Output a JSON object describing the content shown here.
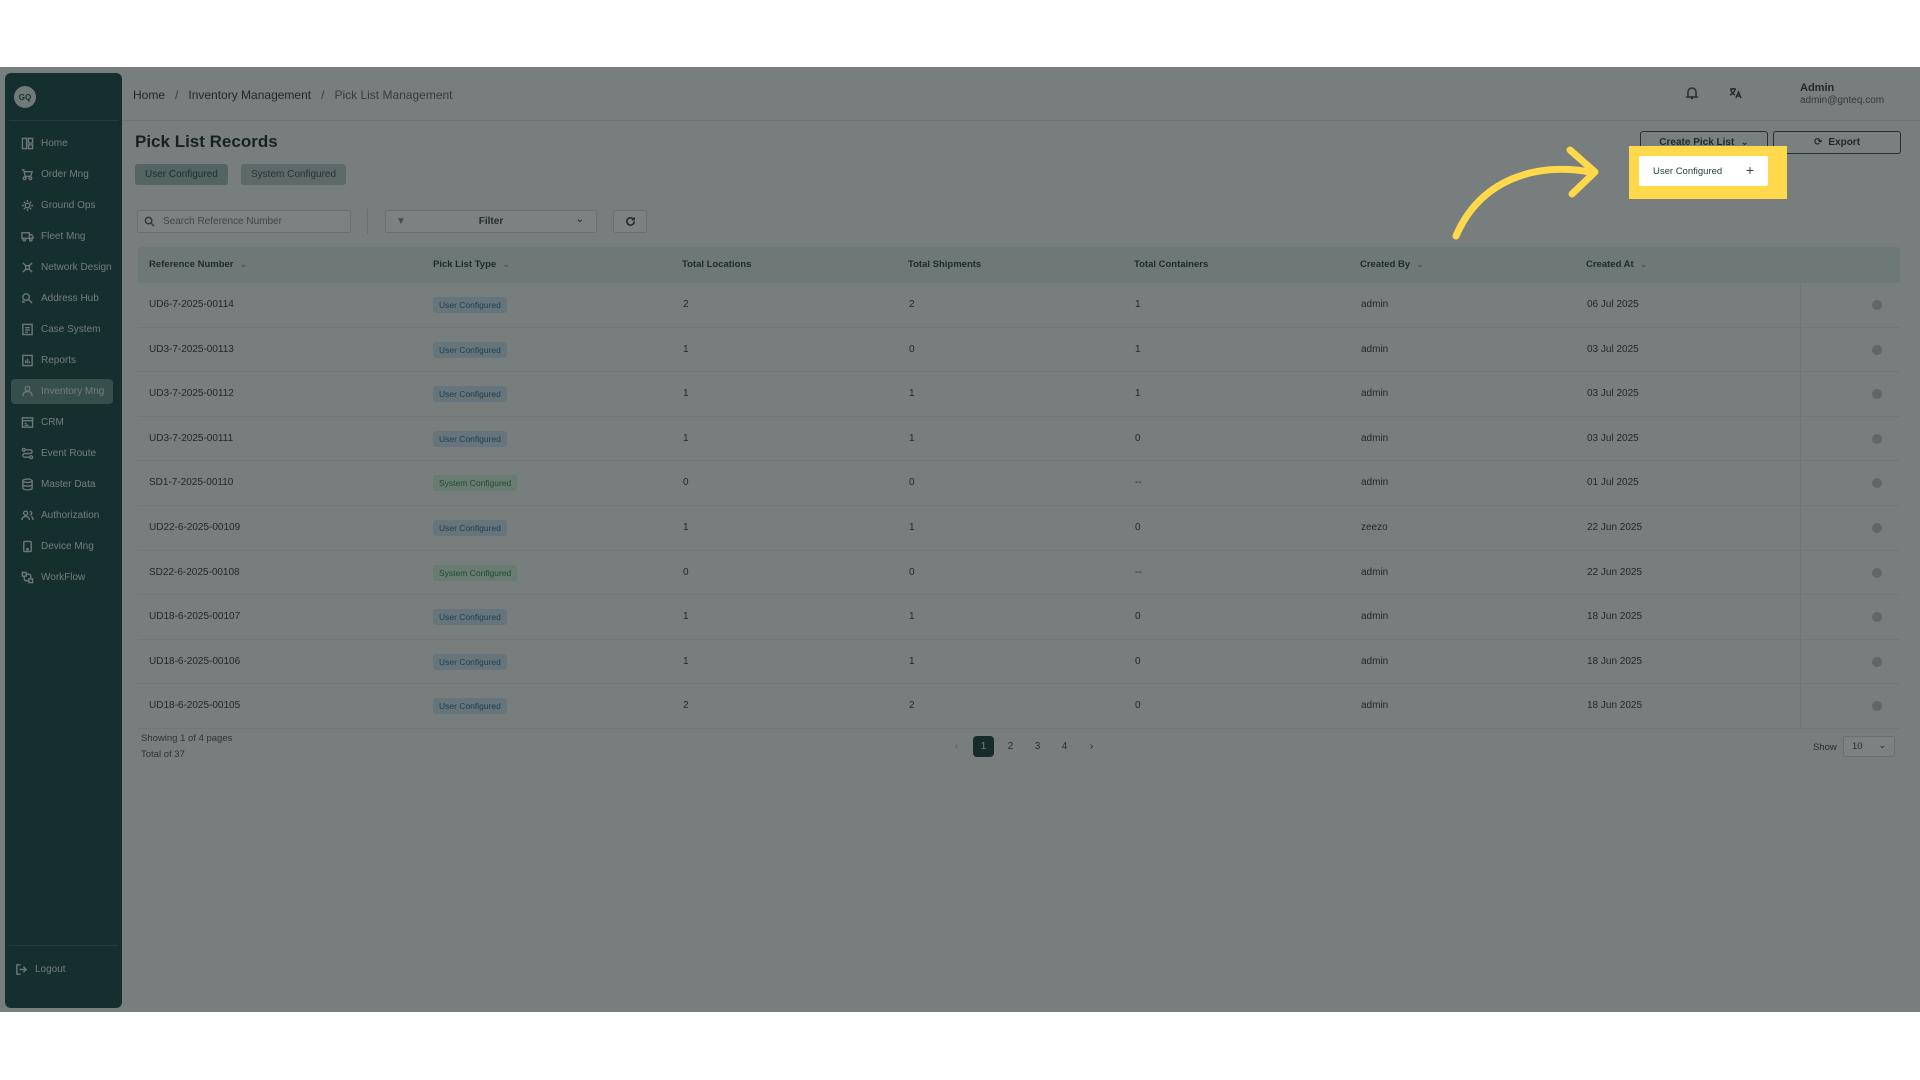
{
  "sidebar": {
    "logo": "GQ",
    "items": [
      {
        "label": "Home",
        "icon": "home-icon"
      },
      {
        "label": "Order Mng",
        "icon": "order-icon"
      },
      {
        "label": "Ground Ops",
        "icon": "ground-ops-icon"
      },
      {
        "label": "Fleet Mng",
        "icon": "truck-icon"
      },
      {
        "label": "Network Design",
        "icon": "network-icon"
      },
      {
        "label": "Address Hub",
        "icon": "location-icon"
      },
      {
        "label": "Case System",
        "icon": "case-icon"
      },
      {
        "label": "Reports",
        "icon": "reports-icon"
      },
      {
        "label": "Inventory Mng",
        "icon": "inventory-icon",
        "active": true
      },
      {
        "label": "CRM",
        "icon": "crm-icon"
      },
      {
        "label": "Event Route",
        "icon": "route-icon"
      },
      {
        "label": "Master Data",
        "icon": "database-icon"
      },
      {
        "label": "Authorization",
        "icon": "users-icon"
      },
      {
        "label": "Device Mng",
        "icon": "device-icon"
      },
      {
        "label": "WorkFlow",
        "icon": "workflow-icon"
      }
    ],
    "logout": "Logout"
  },
  "breadcrumb": [
    "Home",
    "Inventory Management",
    "Pick List Management"
  ],
  "user": {
    "name": "Admin",
    "email": "admin@gnteq.com"
  },
  "page": {
    "title": "Pick List Records"
  },
  "tabs": [
    "User Configured",
    "System Configured"
  ],
  "actions": {
    "create": "Create Pick List",
    "export": "Export"
  },
  "toolbar": {
    "search_placeholder": "Search Reference Number",
    "filter": "Filter"
  },
  "table": {
    "columns": [
      "Reference Number",
      "Pick List Type",
      "Total Locations",
      "Total Shipments",
      "Total Containers",
      "Created By",
      "Created At"
    ],
    "rows": [
      {
        "ref": "UD6-7-2025-00114",
        "type": "User Configured",
        "locations": "2",
        "shipments": "2",
        "containers": "1",
        "by": "admin",
        "at": "06 Jul 2025"
      },
      {
        "ref": "UD3-7-2025-00113",
        "type": "User Configured",
        "locations": "1",
        "shipments": "0",
        "containers": "1",
        "by": "admin",
        "at": "03 Jul 2025"
      },
      {
        "ref": "UD3-7-2025-00112",
        "type": "User Configured",
        "locations": "1",
        "shipments": "1",
        "containers": "1",
        "by": "admin",
        "at": "03 Jul 2025"
      },
      {
        "ref": "UD3-7-2025-00111",
        "type": "User Configured",
        "locations": "1",
        "shipments": "1",
        "containers": "0",
        "by": "admin",
        "at": "03 Jul 2025"
      },
      {
        "ref": "SD1-7-2025-00110",
        "type": "System Configured",
        "locations": "0",
        "shipments": "0",
        "containers": "--",
        "by": "admin",
        "at": "01 Jul 2025"
      },
      {
        "ref": "UD22-6-2025-00109",
        "type": "User Configured",
        "locations": "1",
        "shipments": "1",
        "containers": "0",
        "by": "zeezo",
        "at": "22 Jun 2025"
      },
      {
        "ref": "SD22-6-2025-00108",
        "type": "System Configured",
        "locations": "0",
        "shipments": "0",
        "containers": "--",
        "by": "admin",
        "at": "22 Jun 2025"
      },
      {
        "ref": "UD18-6-2025-00107",
        "type": "User Configured",
        "locations": "1",
        "shipments": "1",
        "containers": "0",
        "by": "admin",
        "at": "18 Jun 2025"
      },
      {
        "ref": "UD18-6-2025-00106",
        "type": "User Configured",
        "locations": "1",
        "shipments": "1",
        "containers": "0",
        "by": "admin",
        "at": "18 Jun 2025"
      },
      {
        "ref": "UD18-6-2025-00105",
        "type": "User Configured",
        "locations": "2",
        "shipments": "2",
        "containers": "0",
        "by": "admin",
        "at": "18 Jun 2025"
      }
    ]
  },
  "footer": {
    "showing": "Showing 1 of 4 pages",
    "total": "Total of 37",
    "pages": [
      "1",
      "2",
      "3",
      "4"
    ],
    "show_label": "Show",
    "page_size": "10"
  },
  "dropdown": {
    "item": "User Configured"
  },
  "colors": {
    "sidebar": "#0c3a39",
    "highlight": "#ffd84b",
    "user_badge": "#cde0f0",
    "system_badge": "#d6eed8"
  }
}
